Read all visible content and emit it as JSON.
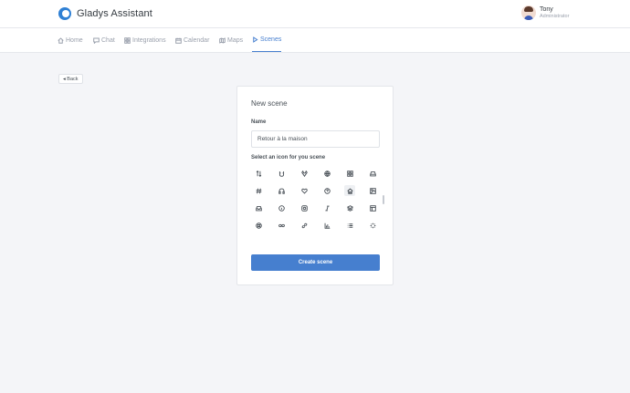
{
  "brand": {
    "name": "Gladys Assistant"
  },
  "user": {
    "name": "Tony",
    "role": "Administrator"
  },
  "nav": {
    "items": [
      {
        "label": "Home",
        "icon": "home-icon"
      },
      {
        "label": "Chat",
        "icon": "message-icon"
      },
      {
        "label": "Integrations",
        "icon": "grid-icon"
      },
      {
        "label": "Calendar",
        "icon": "calendar-icon"
      },
      {
        "label": "Maps",
        "icon": "map-icon"
      },
      {
        "label": "Scenes",
        "icon": "play-icon",
        "active": true
      }
    ]
  },
  "back_label": "◂ Back",
  "scene_form": {
    "title": "New scene",
    "name_label": "Name",
    "name_value": "Retour à la maison",
    "icon_label": "Select an icon for you scene",
    "submit_label": "Create scene",
    "selected_icon": "home-icon",
    "accent_color": "#467fcf"
  }
}
